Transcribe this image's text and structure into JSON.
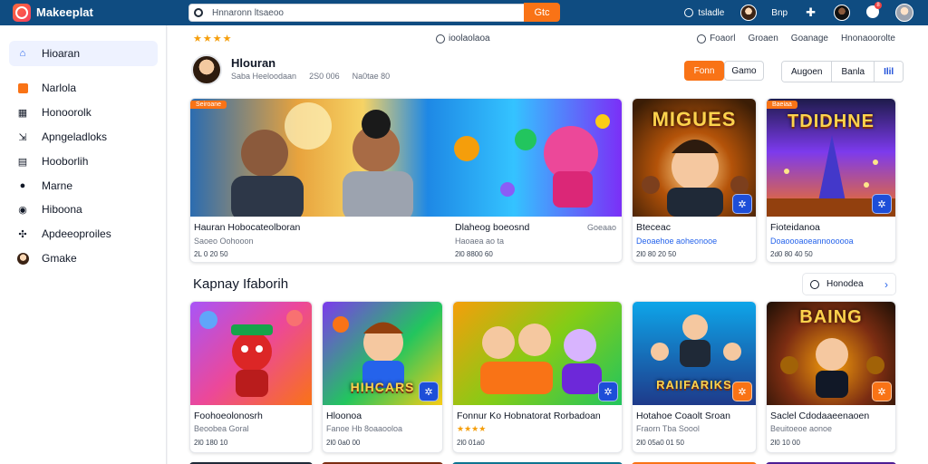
{
  "app": {
    "brand": "Makeeplat"
  },
  "search": {
    "value": "Hnnaronn ltsaeoo",
    "button": "Gtc"
  },
  "topnav": {
    "item1": "tsladle",
    "item2": "Bnp",
    "notif_count": "8"
  },
  "sidebar": {
    "items": [
      {
        "label": "Hioaran",
        "icon": "home-icon"
      },
      {
        "label": "Narlola",
        "icon": "store-icon"
      },
      {
        "label": "Honoorolk",
        "icon": "calendar-icon"
      },
      {
        "label": "Apngeladloks",
        "icon": "download-icon"
      },
      {
        "label": "Hooborlih",
        "icon": "library-icon"
      },
      {
        "label": "Marne",
        "icon": "dot-icon"
      },
      {
        "label": "Hiboona",
        "icon": "globe-icon"
      },
      {
        "label": "Apdeeoproiles",
        "icon": "puzzle-icon"
      },
      {
        "label": "Gmake",
        "icon": "avatar-icon"
      }
    ]
  },
  "header": {
    "rating_stars": "★★★★",
    "center_tab": "ioolaolaoa",
    "links": [
      "Foaorl",
      "Groaen",
      "Goanage",
      "Hnonaoorolte"
    ]
  },
  "profile": {
    "name": "Hlouran",
    "meta": [
      "Saba Heeloodaan",
      "2S0 006",
      "Na0tae 80"
    ],
    "btn_primary": "Fonn",
    "btn_game": "Gamo",
    "segments": [
      "Augoen",
      "Banla",
      "Ilil"
    ]
  },
  "featured": [
    {
      "tag": "Seiroane",
      "title": "Hauran Hobocateolboran",
      "sub": "Saoeo Oohooon",
      "meta": "2L 0 20 50",
      "overlay": "",
      "corner": ""
    },
    {
      "tag": "",
      "title": "Dlaheog boeosnd",
      "sub": "Haoaea ao ta",
      "meta": "2l0 8800 60",
      "right": "Goeaao",
      "overlay": "",
      "corner": ""
    },
    {
      "tag": "",
      "title": "Bteceac",
      "sub": "Deoaehoe aoheonooe",
      "meta": "2l0 80 20 50",
      "overlay": "MIGUES",
      "corner": "✲"
    },
    {
      "tag": "Baeiaa",
      "title": "Fioteidanoa",
      "sub": "Doaoooaoeannoooooa",
      "meta": "2d0 80 40 50",
      "overlay": "TDIDHNE",
      "corner": "✲"
    }
  ],
  "section": {
    "title": "Kapnay Ifaborih",
    "see_all": "Honodea"
  },
  "games": [
    {
      "title": "Foohoeolonosrh",
      "sub": "Beoobea Goral",
      "meta": "2l0 180 10",
      "overlay": "",
      "corner": ""
    },
    {
      "title": "Hloonoa",
      "sub": "Fanoe Hb 8oaaooloa",
      "meta": "2l0 0a0 00",
      "overlay": "HIHCARS",
      "corner": "✲"
    },
    {
      "title": "Fonnur Ko Hobnatorat Rorbadoan",
      "sub": "★★★★",
      "meta": "2l0 01a0",
      "overlay": "",
      "corner": "✲"
    },
    {
      "title": "Hotahoe Coaolt Sroan",
      "sub": "Fraorn Tba Soool",
      "meta": "2l0 05a0 01 50",
      "overlay": "RAIIFARIKS",
      "corner": "✲"
    },
    {
      "title": "Saclel Cdodaaeenaoen",
      "sub": "Beuitoeoe aonoe",
      "meta": "2l0 10 00",
      "overlay": "BAING",
      "corner": "✲"
    }
  ],
  "colors": {
    "topbar": "#0f4c81",
    "accent": "#f97316",
    "link": "#2563eb"
  }
}
